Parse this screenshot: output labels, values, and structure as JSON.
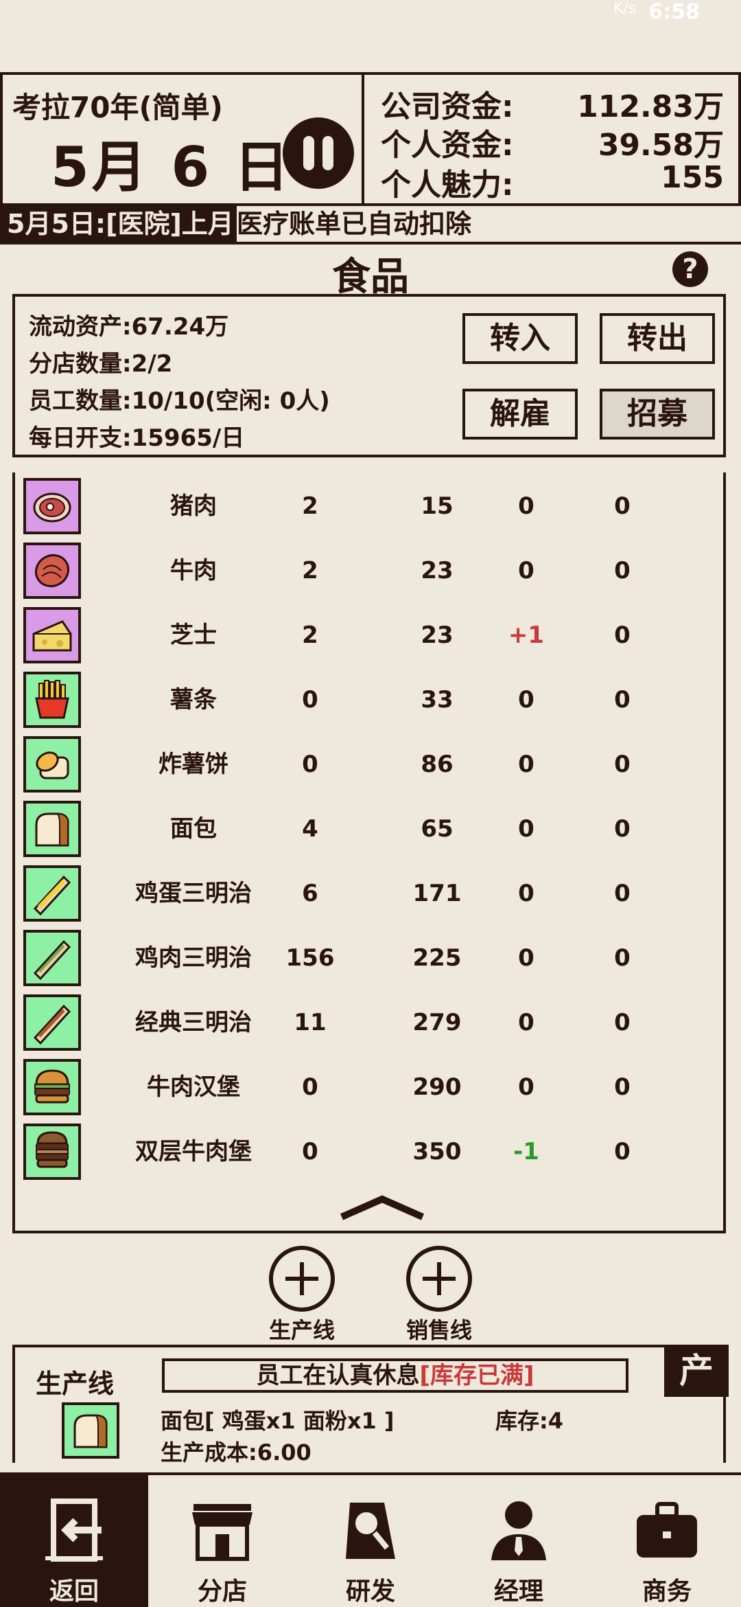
{
  "status_bar": {
    "net_speed": "K/s",
    "time": "6:58"
  },
  "header": {
    "year_label": "考拉70年(简单)",
    "date": "5月 6 日",
    "funds": [
      {
        "label": "公司资金:",
        "value": "112.83万"
      },
      {
        "label": "个人资金:",
        "value": "39.58万"
      },
      {
        "label": "个人魅力:",
        "value": "155"
      }
    ]
  },
  "ticker": {
    "date_tag": "5月5日:[医院]上月",
    "message": "医疗账单已自动扣除"
  },
  "section": {
    "title": "食品",
    "help": "?"
  },
  "info": {
    "lines": [
      "流动资产:67.24万",
      "分店数量:2/2",
      "员工数量:10/10(空闲: 0人)",
      "每日开支:15965/日"
    ],
    "buttons": {
      "transfer_in": "转入",
      "transfer_out": "转出",
      "fire": "解雇",
      "recruit": "招募"
    }
  },
  "products": [
    {
      "name": "猪肉",
      "a": "2",
      "b": "15",
      "c": "0",
      "d": "0",
      "icon": "pork-icon"
    },
    {
      "name": "牛肉",
      "a": "2",
      "b": "23",
      "c": "0",
      "d": "0",
      "icon": "beef-icon"
    },
    {
      "name": "芝士",
      "a": "2",
      "b": "23",
      "c": "+1",
      "d": "0",
      "icon": "cheese-icon"
    },
    {
      "name": "薯条",
      "a": "0",
      "b": "33",
      "c": "0",
      "d": "0",
      "icon": "fries-icon"
    },
    {
      "name": "炸薯饼",
      "a": "0",
      "b": "86",
      "c": "0",
      "d": "0",
      "icon": "hashbrown-icon"
    },
    {
      "name": "面包",
      "a": "4",
      "b": "65",
      "c": "0",
      "d": "0",
      "icon": "bread-icon"
    },
    {
      "name": "鸡蛋三明治",
      "a": "6",
      "b": "171",
      "c": "0",
      "d": "0",
      "icon": "egg-sandwich-icon"
    },
    {
      "name": "鸡肉三明治",
      "a": "156",
      "b": "225",
      "c": "0",
      "d": "0",
      "icon": "chicken-sandwich-icon"
    },
    {
      "name": "经典三明治",
      "a": "11",
      "b": "279",
      "c": "0",
      "d": "0",
      "icon": "classic-sandwich-icon"
    },
    {
      "name": "牛肉汉堡",
      "a": "0",
      "b": "290",
      "c": "0",
      "d": "0",
      "icon": "burger-icon"
    },
    {
      "name": "双层牛肉堡",
      "a": "0",
      "b": "350",
      "c": "-1",
      "d": "0",
      "icon": "double-burger-icon"
    }
  ],
  "add_lines": {
    "production": "生产线",
    "sales": "销售线"
  },
  "production": {
    "title": "生产线",
    "status_normal": "员工在认真休息",
    "status_warn": "[库存已满]",
    "tag": "产",
    "recipe": "面包[ 鸡蛋x1  面粉x1 ]",
    "stock": "库存:4",
    "cost": "生产成本:6.00"
  },
  "nav": {
    "back": "返回",
    "branch": "分店",
    "research": "研发",
    "manager": "经理",
    "business": "商务"
  },
  "colors": {
    "ink": "#2a1410",
    "paper": "#efe8dc",
    "purple_tile": "#d99be6",
    "green_tile": "#8ef0a4",
    "up": "#c9383a",
    "down": "#2a9a2a"
  }
}
